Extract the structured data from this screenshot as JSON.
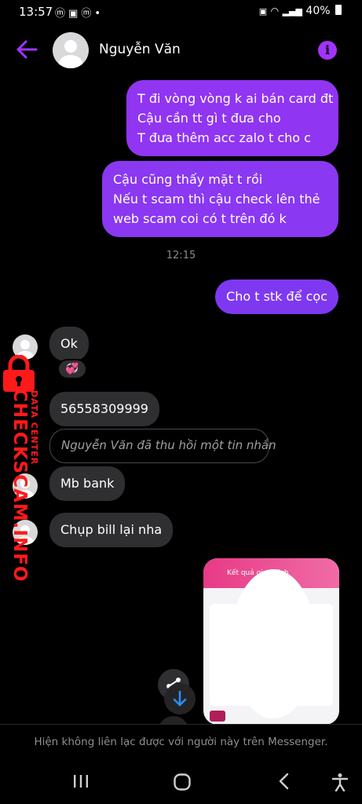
{
  "status_bar": {
    "time": "13:57",
    "notification_icons": [
      "messenger-icon",
      "image-icon",
      "messenger-icon",
      "dot-icon"
    ],
    "battery": "40%"
  },
  "header": {
    "contact_name": "Nguyễn Văn",
    "accent_color": "#a233ff"
  },
  "messages": {
    "outgoing_1": [
      "T đi vòng vòng k ai bán card đt",
      "Cậu cần tt gì t đưa cho",
      "T đưa thêm acc zalo t cho c"
    ],
    "outgoing_2": [
      "Cậu cũng thấy mặt t rồi",
      "Nếu t scam thì cậu check lên thẻ",
      "web scam coi có t trên đó k"
    ],
    "timestamp": "12:15",
    "outgoing_3": "Cho t stk để cọc",
    "incoming_ok": "Ok",
    "reaction": "💞",
    "incoming_number": "56558309999",
    "unsent_notice": "Nguyễn Văn đã thu hồi một tin nhắn",
    "incoming_bank": "Mb bank",
    "incoming_bill": "Chụp bill lại nha"
  },
  "image_message": {
    "title": "Kết quả giao dịch"
  },
  "watermark": {
    "site": "CHECKSCAM.INFO",
    "tagline": "DATA CENTER"
  },
  "footer": {
    "notice": "Hiện không liên lạc được với người này trên Messenger."
  },
  "colors": {
    "bubble_out": "#9035f2",
    "bubble_in": "#2f2f32",
    "background": "#000000"
  }
}
